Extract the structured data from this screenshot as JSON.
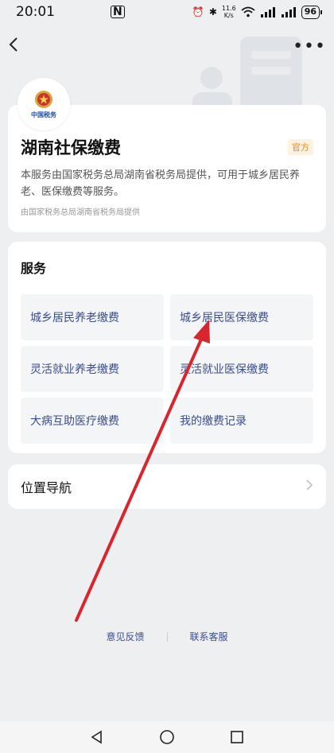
{
  "status_bar": {
    "time": "20:01",
    "nfc": "N",
    "speed_value": "11.6",
    "speed_unit": "K/s",
    "battery": "96"
  },
  "nav": {
    "back_icon": "back-chevron",
    "more_icon": "more-dots"
  },
  "info": {
    "logo_text": "中国税务",
    "title": "湖南社保缴费",
    "badge": "官方",
    "description": "本服务由国家税务总局湖南省税务局提供，可用于城乡居民养老、医保缴费等服务。",
    "provider": "由国家税务总局湖南省税务局提供"
  },
  "services": {
    "title": "服务",
    "items": [
      {
        "label": "城乡居民养老缴费"
      },
      {
        "label": "城乡居民医保缴费"
      },
      {
        "label": "灵活就业养老缴费"
      },
      {
        "label": "灵活就业医保缴费"
      },
      {
        "label": "大病互助医疗缴费"
      },
      {
        "label": "我的缴费记录"
      }
    ]
  },
  "location_nav": {
    "label": "位置导航"
  },
  "footer": {
    "feedback": "意见反馈",
    "support": "联系客服"
  },
  "colors": {
    "accent_text": "#3b4e8c",
    "badge_text": "#e38b1f",
    "arrow": "#d8262e"
  }
}
